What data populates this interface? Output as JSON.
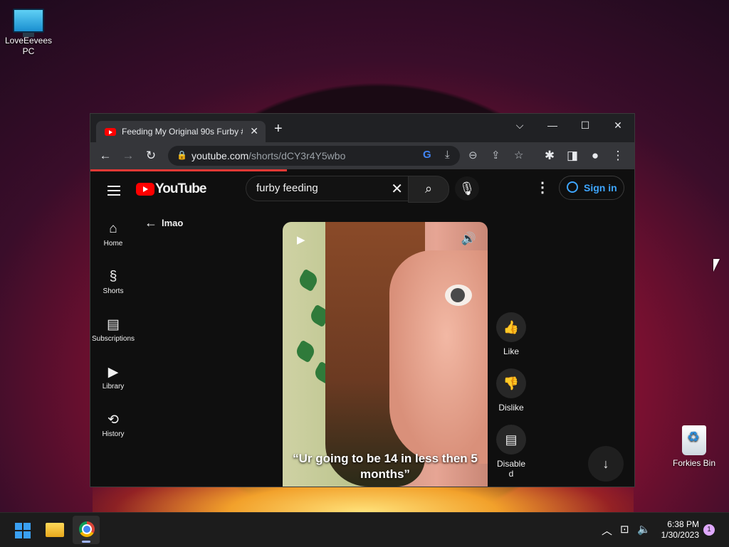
{
  "desktop": {
    "pc_icon_label": "LoveEevees PC",
    "bin_icon_label": "Forkies Bin"
  },
  "browser": {
    "tab_title": "Feeding My Original 90s Furby #",
    "tab_close": "✕",
    "new_tab": "+",
    "url_host": "youtube.com",
    "url_path": "/shorts/dCY3r4Y5wbo"
  },
  "youtube": {
    "logo_text": "YouTube",
    "search_value": "furby feeding",
    "sign_in": "Sign in",
    "back_label": "lmao",
    "guide": [
      {
        "label": "Home",
        "icon": "home-icon"
      },
      {
        "label": "Shorts",
        "icon": "shorts-icon"
      },
      {
        "label": "Subscriptions",
        "icon": "subscriptions-icon"
      },
      {
        "label": "Library",
        "icon": "library-icon"
      },
      {
        "label": "History",
        "icon": "history-icon"
      }
    ],
    "caption": "“Ur going to be 14 in less then 5 months”",
    "actions": {
      "like": "Like",
      "dislike": "Dislike",
      "comments": "Disable d"
    }
  },
  "taskbar": {
    "time": "6:38 PM",
    "date": "1/30/2023",
    "notification_count": "1"
  },
  "colors": {
    "youtube_red": "#ff0000",
    "signin_blue": "#3ea6ff",
    "windows_blue": "#3aa0f3"
  }
}
